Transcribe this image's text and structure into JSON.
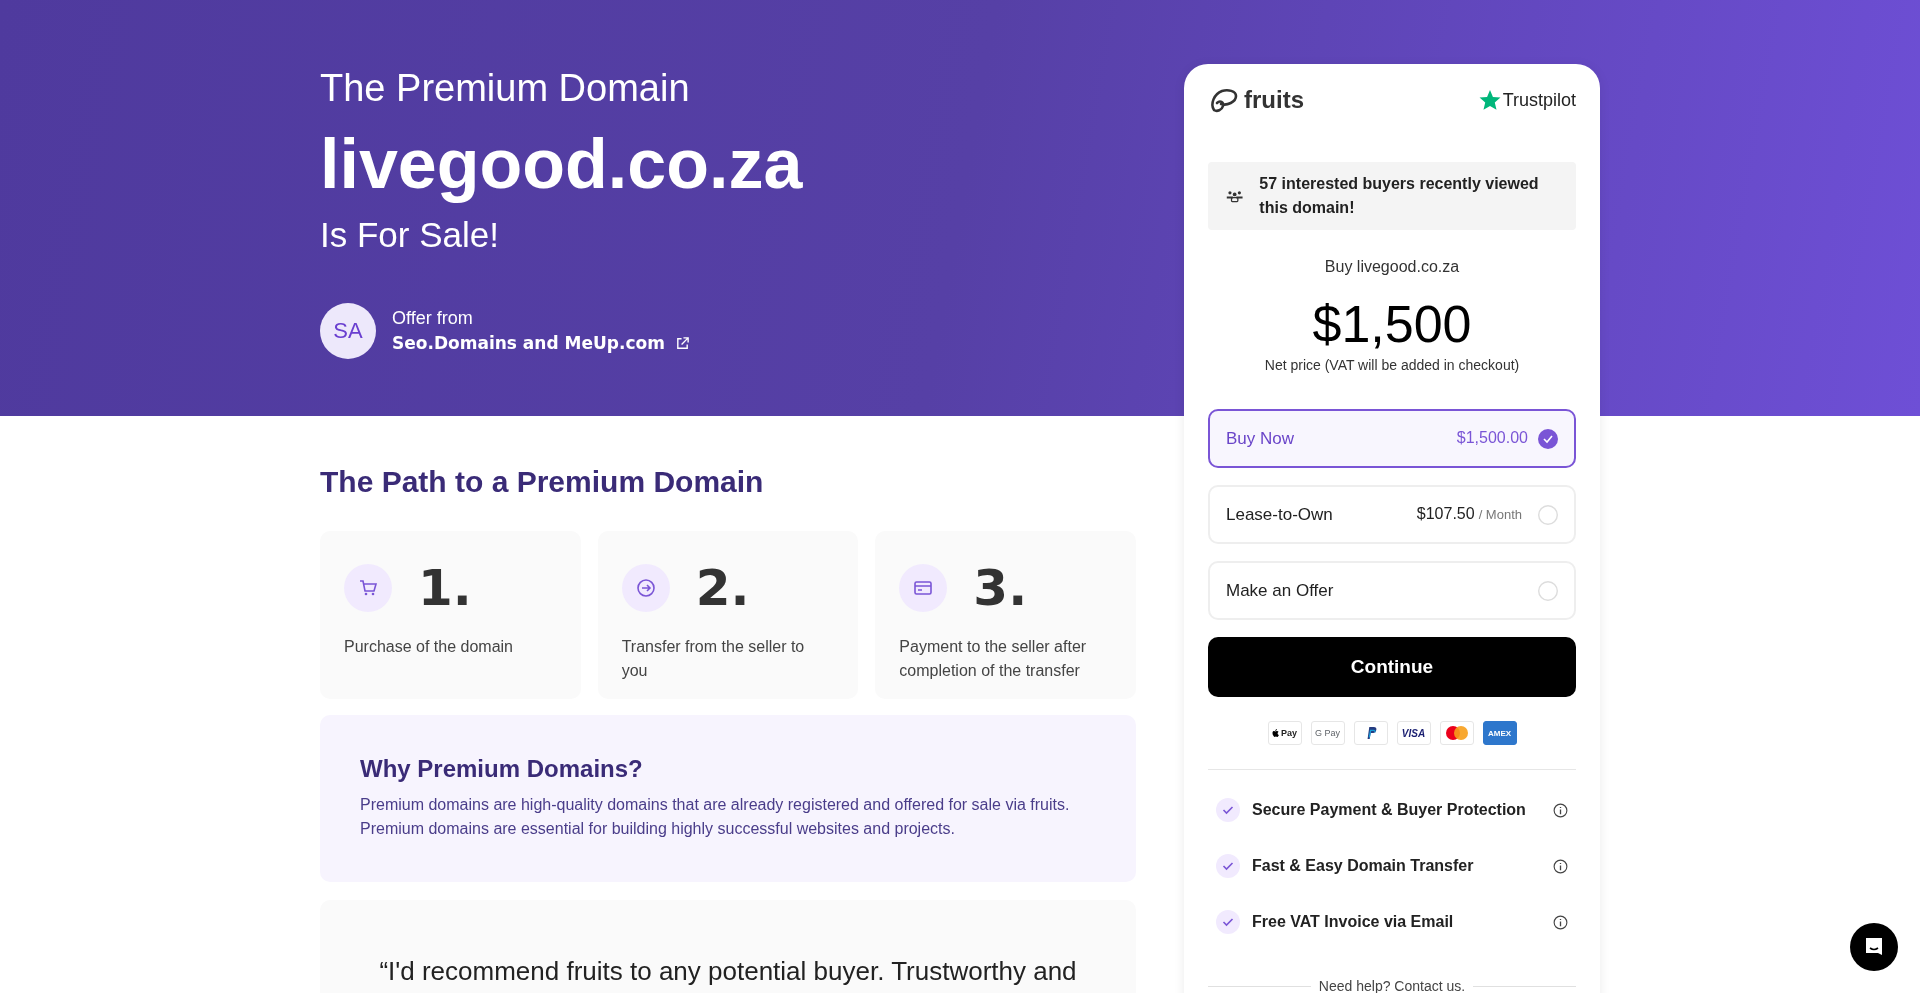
{
  "hero": {
    "eyebrow": "The Premium Domain",
    "domain": "livegood.co.za",
    "tagline": "Is For Sale!",
    "seller": {
      "initials": "SA",
      "label": "Offer from",
      "name": "Seo.Domains and MeUp.com"
    }
  },
  "path": {
    "title": "The Path to a Premium Domain",
    "steps": [
      {
        "kind": "cart",
        "number": "1.",
        "text": "Purchase of the domain"
      },
      {
        "kind": "arrow",
        "number": "2.",
        "text": "Transfer from the seller to you"
      },
      {
        "kind": "card",
        "number": "3.",
        "text": "Payment to the seller after completion of the transfer"
      }
    ]
  },
  "why": {
    "title": "Why Premium Domains?",
    "text": "Premium domains are high-quality domains that are already registered and offered for sale via fruits. Premium domains are essential for building highly successful websites and projects."
  },
  "testimonial": {
    "quote": "“I'd recommend fruits to any potential buyer. Trustworthy and"
  },
  "checkout": {
    "brand": "fruits",
    "rating_site": "Trustpilot",
    "notice": "57 interested buyers recently viewed this domain!",
    "buy_label": "Buy livegood.co.za",
    "price": "$1,500",
    "price_note": "Net price (VAT will be added in checkout)",
    "options": [
      {
        "label": "Buy Now",
        "price": "$1,500.00",
        "selected": true
      },
      {
        "label": "Lease-to-Own",
        "price": "$107.50",
        "unit": "/ Month",
        "selected": false
      },
      {
        "label": "Make an Offer",
        "selected": false
      }
    ],
    "continue": "Continue",
    "payment_methods": [
      {
        "kind": "applepay",
        "label": "Pay"
      },
      {
        "kind": "googlepay",
        "label": "G Pay"
      },
      {
        "kind": "paypal"
      },
      {
        "kind": "visa",
        "label": "VISA"
      },
      {
        "kind": "mastercard"
      },
      {
        "kind": "amex",
        "label": "AMEX"
      }
    ],
    "features": [
      "Secure Payment & Buyer Protection",
      "Fast & Easy Domain Transfer",
      "Free VAT Invoice via Email"
    ],
    "help": "Need help? Contact us."
  }
}
